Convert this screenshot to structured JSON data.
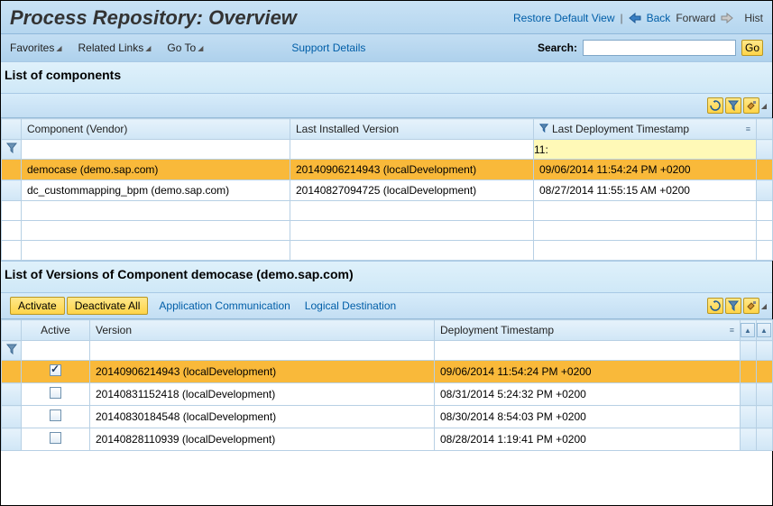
{
  "header": {
    "title": "Process Repository: Overview",
    "restore_link": "Restore Default View",
    "back_label": "Back",
    "forward_label": "Forward",
    "history_label": "Hist"
  },
  "toolbar": {
    "favorites": "Favorites",
    "related_links": "Related Links",
    "go_to": "Go To",
    "support_details": "Support Details",
    "search_label": "Search:",
    "search_value": "",
    "go": "Go"
  },
  "section1": {
    "title": "List of components",
    "columns": {
      "component": "Component (Vendor)",
      "version": "Last Installed Version",
      "timestamp": "Last Deployment Timestamp"
    },
    "filter_values": {
      "component": "",
      "version": "",
      "timestamp": "11:"
    },
    "rows": [
      {
        "component": "democase (demo.sap.com)",
        "version": "20140906214943 (localDevelopment)",
        "timestamp": "09/06/2014 11:54:24 PM +0200",
        "selected": true
      },
      {
        "component": "dc_custommapping_bpm (demo.sap.com)",
        "version": "20140827094725 (localDevelopment)",
        "timestamp": "08/27/2014 11:55:15 AM +0200",
        "selected": false
      }
    ]
  },
  "section2": {
    "title": "List of Versions of Component democase (demo.sap.com)",
    "buttons": {
      "activate": "Activate",
      "deactivate_all": "Deactivate All",
      "app_comm": "Application Communication",
      "logical_dest": "Logical Destination"
    },
    "columns": {
      "active": "Active",
      "version": "Version",
      "timestamp": "Deployment Timestamp"
    },
    "rows": [
      {
        "active": true,
        "version": "20140906214943 (localDevelopment)",
        "timestamp": "09/06/2014 11:54:24 PM +0200",
        "selected": true
      },
      {
        "active": false,
        "version": "20140831152418 (localDevelopment)",
        "timestamp": "08/31/2014 5:24:32 PM +0200",
        "selected": false
      },
      {
        "active": false,
        "version": "20140830184548 (localDevelopment)",
        "timestamp": "08/30/2014 8:54:03 PM +0200",
        "selected": false
      },
      {
        "active": false,
        "version": "20140828110939 (localDevelopment)",
        "timestamp": "08/28/2014 1:19:41 PM +0200",
        "selected": false
      }
    ]
  }
}
